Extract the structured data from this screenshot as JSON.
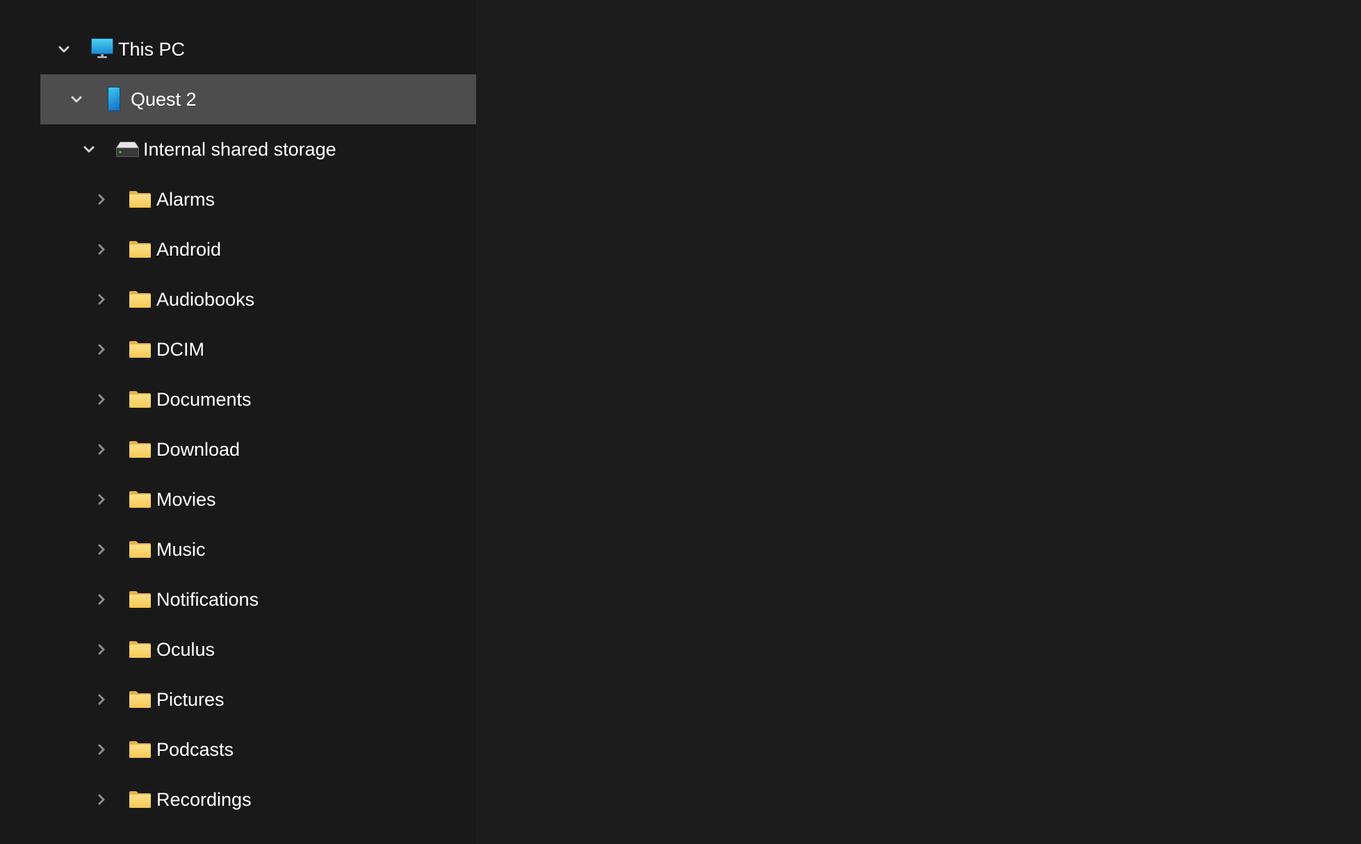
{
  "navigation_pane": {
    "this_pc": {
      "label": "This PC",
      "icon": "monitor-icon",
      "expanded": true
    },
    "device": {
      "label": "Quest 2",
      "icon": "phone-icon",
      "expanded": true,
      "selected": true
    },
    "storage": {
      "label": "Internal shared storage",
      "icon": "drive-icon",
      "expanded": true
    },
    "folders": [
      {
        "label": "Alarms",
        "icon": "folder-icon"
      },
      {
        "label": "Android",
        "icon": "folder-icon"
      },
      {
        "label": "Audiobooks",
        "icon": "folder-icon"
      },
      {
        "label": "DCIM",
        "icon": "folder-icon"
      },
      {
        "label": "Documents",
        "icon": "folder-icon"
      },
      {
        "label": "Download",
        "icon": "folder-icon"
      },
      {
        "label": "Movies",
        "icon": "folder-icon"
      },
      {
        "label": "Music",
        "icon": "folder-icon"
      },
      {
        "label": "Notifications",
        "icon": "folder-icon"
      },
      {
        "label": "Oculus",
        "icon": "folder-icon"
      },
      {
        "label": "Pictures",
        "icon": "folder-icon"
      },
      {
        "label": "Podcasts",
        "icon": "folder-icon"
      },
      {
        "label": "Recordings",
        "icon": "folder-icon"
      }
    ]
  },
  "colors": {
    "background": "#1c1c1c",
    "nav_background": "#191919",
    "selected_row": "#4d4d4d",
    "text": "#ffffff",
    "chevron_expanded": "#cfcfcf",
    "chevron_collapsed": "#8c8c8c",
    "folder": "#f8d775"
  }
}
